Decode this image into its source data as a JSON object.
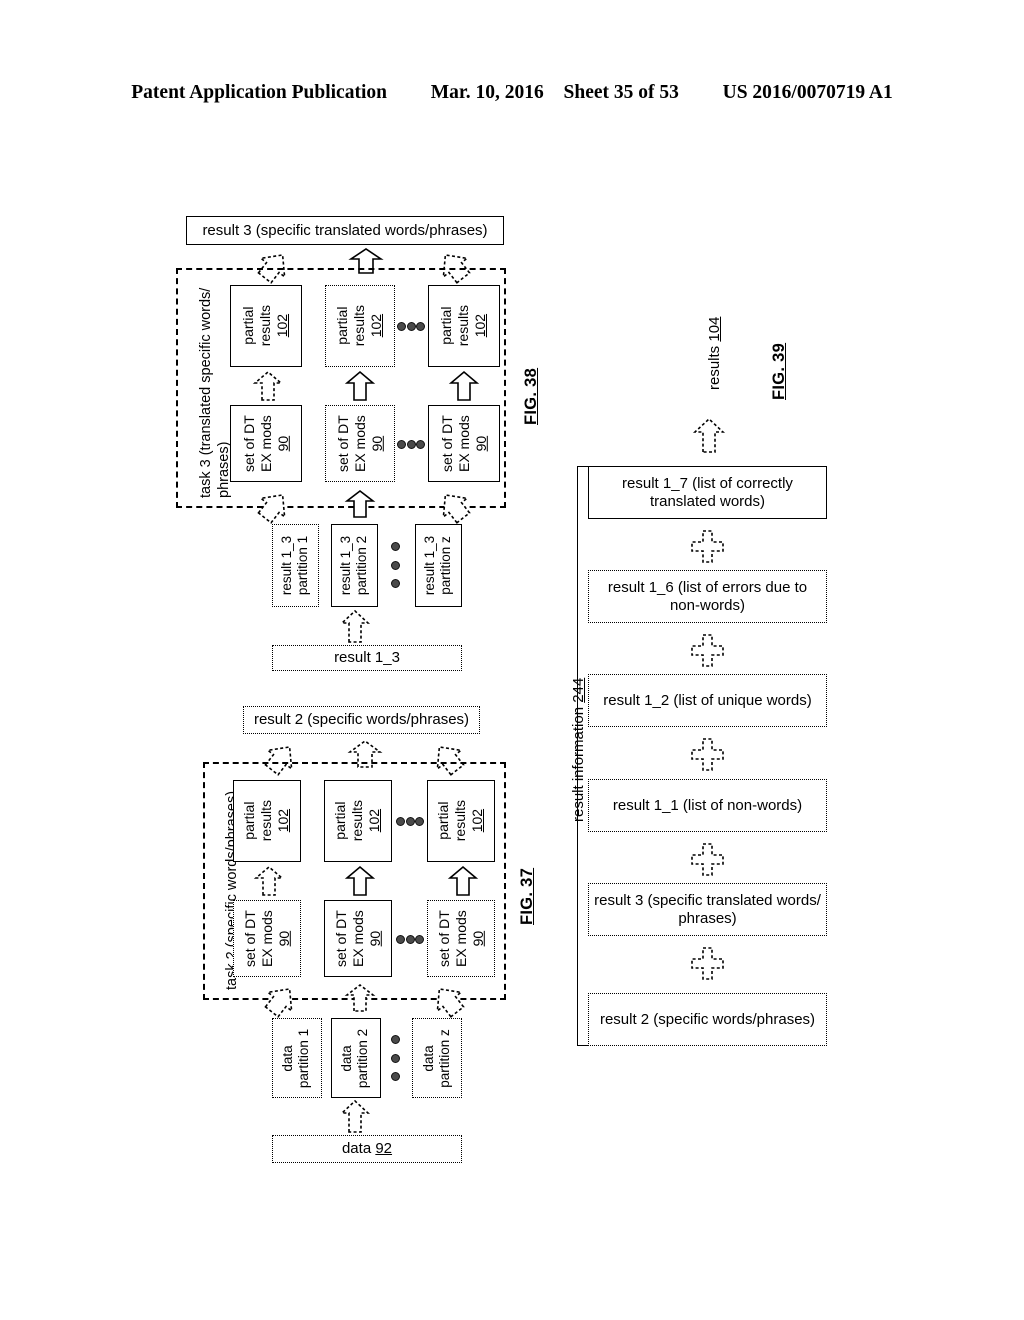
{
  "header": {
    "publication": "Patent Application Publication",
    "date": "Mar. 10, 2016",
    "sheet": "Sheet 35 of 53",
    "patent_number": "US 2016/0070719 A1"
  },
  "fig38": {
    "label": "FIG. 38",
    "output_box": "result  3 (specific translated words/phrases)",
    "container_label": "task 3 (translated specific words/ phrases)",
    "partial_results": [
      {
        "line1": "partial",
        "line2": "results",
        "ref": "102"
      },
      {
        "line1": "partial",
        "line2": "results",
        "ref": "102"
      },
      {
        "line1": "partial",
        "line2": "results",
        "ref": "102"
      }
    ],
    "dt_ex_mods": [
      {
        "line1": "set of DT",
        "line2": "EX mods",
        "ref": "90"
      },
      {
        "line1": "set of DT",
        "line2": "EX mods",
        "ref": "90"
      },
      {
        "line1": "set of DT",
        "line2": "EX mods",
        "ref": "90"
      }
    ],
    "partitions": [
      {
        "line1": "result 1_3",
        "line2": "partition 1"
      },
      {
        "line1": "result 1_3",
        "line2": "partition 2"
      },
      {
        "line1": "result 1_3",
        "line2": "partition z"
      }
    ],
    "input_box": "result 1_3"
  },
  "fig37": {
    "label": "FIG. 37",
    "output_box": "result  2 (specific words/phrases)",
    "container_label": "task 2 (specific words/phrases)",
    "partial_results": [
      {
        "line1": "partial",
        "line2": "results",
        "ref": "102"
      },
      {
        "line1": "partial",
        "line2": "results",
        "ref": "102"
      },
      {
        "line1": "partial",
        "line2": "results",
        "ref": "102"
      }
    ],
    "dt_ex_mods": [
      {
        "line1": "set of DT",
        "line2": "EX mods",
        "ref": "90"
      },
      {
        "line1": "set of DT",
        "line2": "EX mods",
        "ref": "90"
      },
      {
        "line1": "set of DT",
        "line2": "EX mods",
        "ref": "90"
      }
    ],
    "partitions": [
      {
        "line1": "data",
        "line2": "partition 1"
      },
      {
        "line1": "data",
        "line2": "partition 2"
      },
      {
        "line1": "data",
        "line2": "partition z"
      }
    ],
    "input_box_text": "data ",
    "input_box_ref": "92"
  },
  "fig39": {
    "label": "FIG. 39",
    "output_label_text": "results ",
    "output_label_ref": "104",
    "bracket_label_text": "result information ",
    "bracket_label_ref": "244",
    "rows": [
      "result 1_7 (list of correctly translated words)",
      "result 1_6 (list of errors due to non-words)",
      "result 1_2 (list of unique words)",
      "result 1_1 (list of non-words)",
      "result  3 (specific translated words/ phrases)",
      "result  2 (specific words/phrases)"
    ],
    "rows_lines": [
      [
        "result 1_7 (list of correctly",
        "translated words)"
      ],
      [
        "result 1_6 (list of errors due to",
        "non-words)"
      ],
      [
        "result 1_2 (list of unique words)"
      ],
      [
        "result 1_1 (list of non-words)"
      ],
      [
        "result  3 (specific translated words/",
        "phrases)"
      ],
      [
        "result  2 (specific words/phrases)"
      ]
    ]
  },
  "colors": {
    "ink": "#000000",
    "paper": "#ffffff",
    "dot_fill": "#4a4a4a"
  }
}
